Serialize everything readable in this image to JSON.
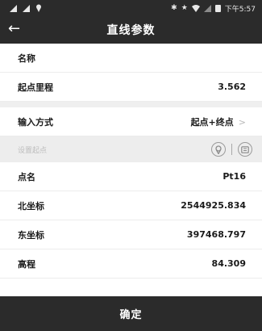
{
  "status_bar": {
    "time": "下午5:57"
  },
  "header": {
    "title": "直线参数"
  },
  "form": {
    "name_label": "名称",
    "name_value": "",
    "start_mileage_label": "起点里程",
    "start_mileage_value": "3.562",
    "input_mode_label": "输入方式",
    "input_mode_value": "起点+终点",
    "set_start_label": "设置起点",
    "point_name_label": "点名",
    "point_name_value": "Pt16",
    "north_label": "北坐标",
    "north_value": "2544925.834",
    "east_label": "东坐标",
    "east_value": "397468.797",
    "elevation_label": "高程",
    "elevation_value": "84.309"
  },
  "footer": {
    "confirm_label": "确定"
  }
}
